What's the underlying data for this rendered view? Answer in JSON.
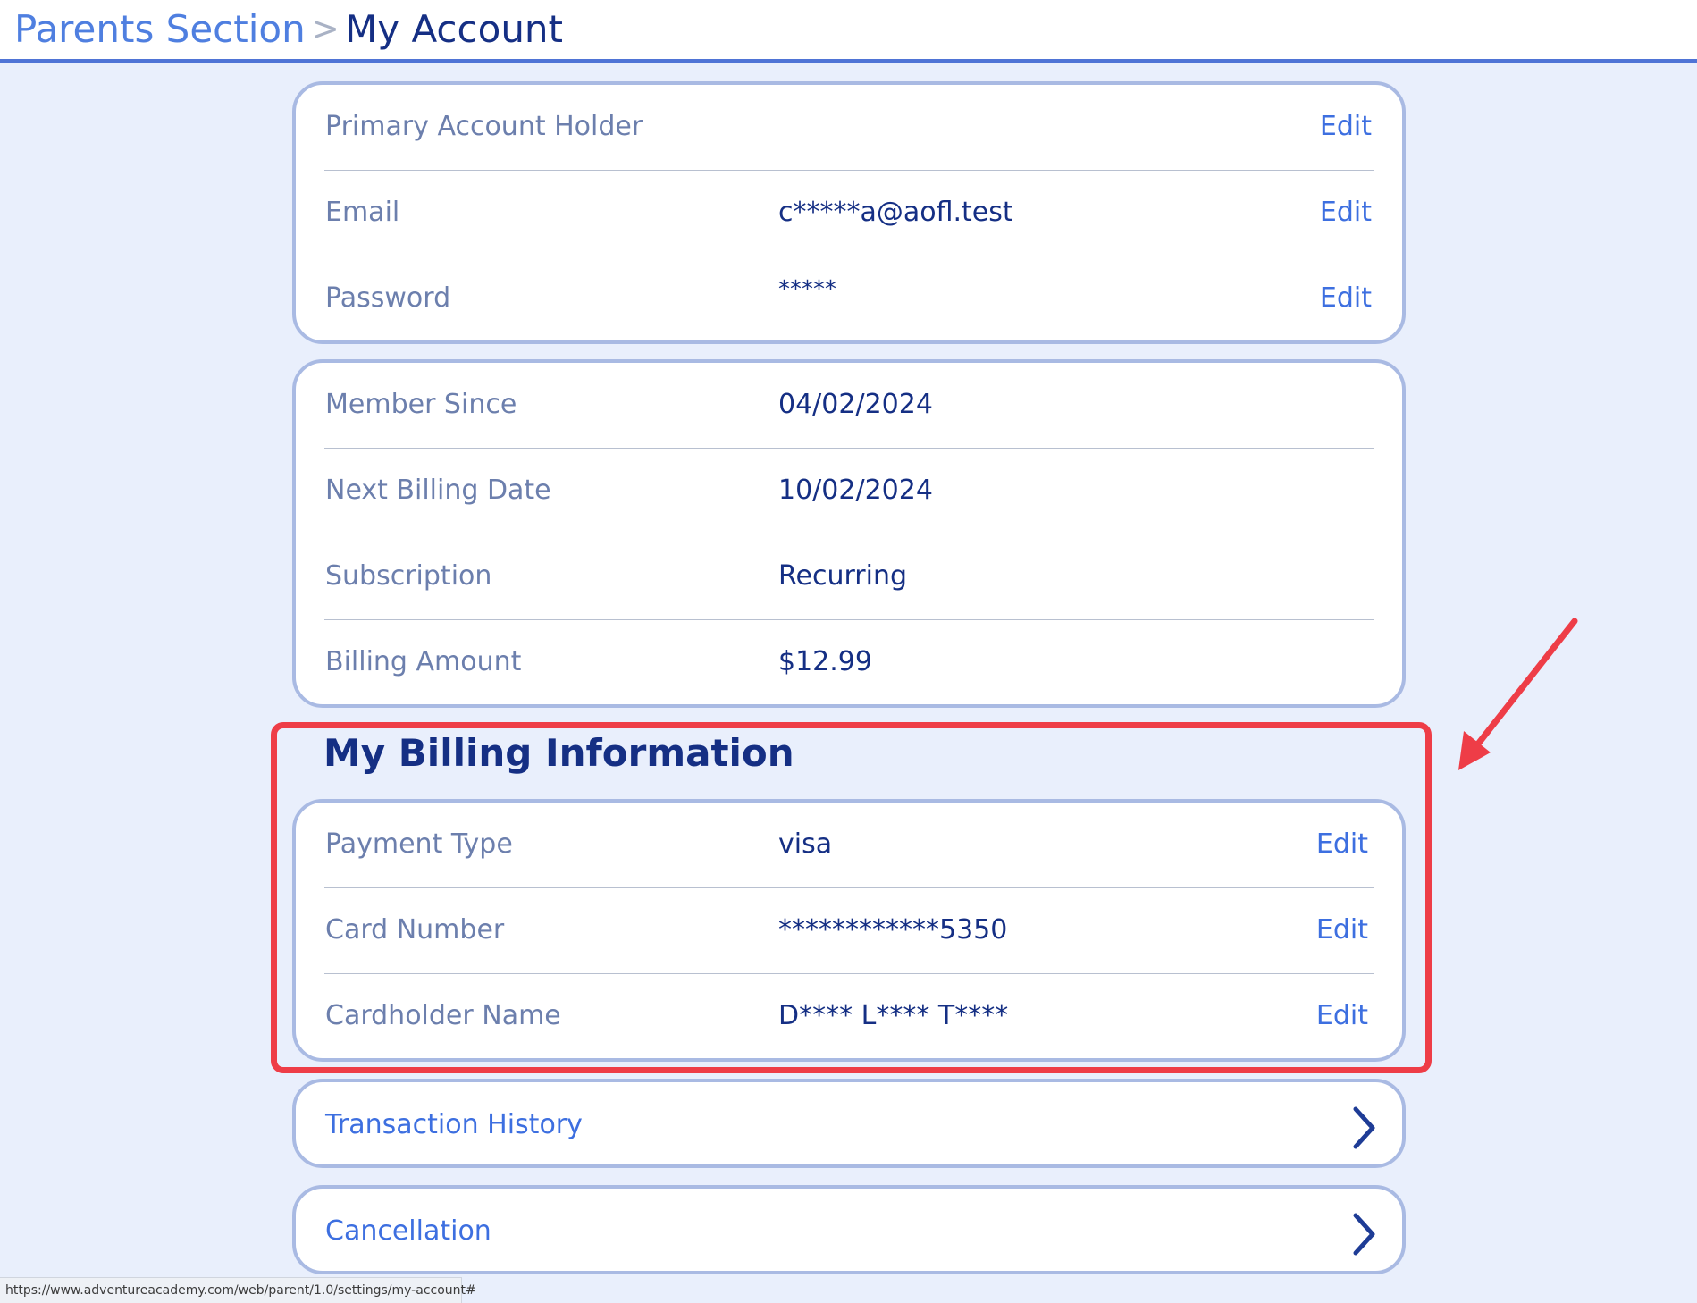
{
  "header": {
    "parent": "Parents Section",
    "separator": ">",
    "current": "My Account"
  },
  "account": {
    "primary_label": "Primary Account Holder",
    "email_label": "Email",
    "email_value": "c*****a@aofl.test",
    "password_label": "Password",
    "password_value": "*****",
    "edit_label": "Edit"
  },
  "membership": {
    "member_since_label": "Member Since",
    "member_since_value": "04/02/2024",
    "next_billing_label": "Next Billing Date",
    "next_billing_value": "10/02/2024",
    "subscription_label": "Subscription",
    "subscription_value": "Recurring",
    "billing_amount_label": "Billing Amount",
    "billing_amount_value": "$12.99"
  },
  "billing": {
    "title": "My Billing Information",
    "payment_type_label": "Payment Type",
    "payment_type_value": "visa",
    "card_number_label": "Card Number",
    "card_number_value": "************5350",
    "cardholder_label": "Cardholder Name",
    "cardholder_value": "D**** L**** T****",
    "edit_label": "Edit"
  },
  "links": {
    "transaction_history": "Transaction History",
    "cancellation": "Cancellation"
  },
  "status_bar": {
    "url": "https://www.adventureacademy.com/web/parent/1.0/settings/my-account#"
  },
  "colors": {
    "background": "#e9effc",
    "brand_dark": "#152f84",
    "accent_blue": "#3d6fe0",
    "label_gray": "#6c7fad",
    "highlight_red": "#ee3d47"
  },
  "icons": {
    "chevron": "chevron-right-icon",
    "annotation": "red-arrow-icon"
  }
}
